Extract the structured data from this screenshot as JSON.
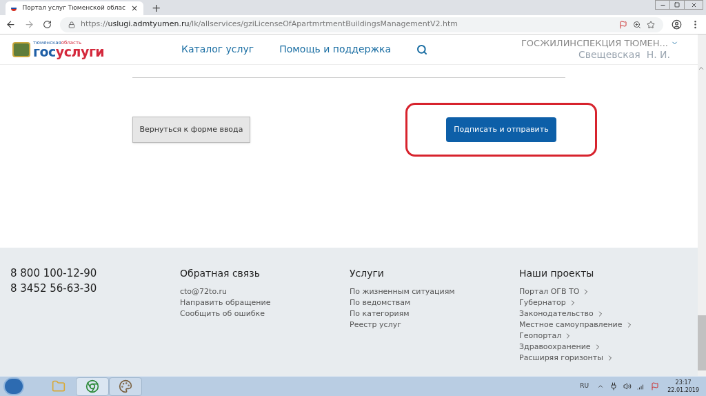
{
  "browser": {
    "tab_title": "Портал услуг Тюменской облас",
    "tab_close": "×",
    "new_tab": "+",
    "url_scheme": "https://",
    "url_host": "uslugi.admtyumen.ru",
    "url_path": "/lk/allservices/gziLicenseOfApartmrtmentBuildingsManagementV2.htm"
  },
  "header": {
    "logo_region_1": "тюменская",
    "logo_region_2": "область",
    "logo_word_1": "гос",
    "logo_word_2": "услуги",
    "nav": [
      "Каталог услуг",
      "Помощь и поддержка"
    ],
    "organization": "ГОСЖИЛИНСПЕКЦИЯ ТЮМЕН...",
    "user": "Свещевская  Н. И."
  },
  "form": {
    "back_button": "Вернуться к форме ввода",
    "submit_button": "Подписать и отправить",
    "submit_highlighted": true
  },
  "footer": {
    "phones": [
      "8 800 100-12-90",
      "8 3452 56-63-30"
    ],
    "columns": [
      {
        "title": "Обратная связь",
        "links": [
          "cto@72to.ru",
          "Направить обращение",
          "Сообщить об ошибке"
        ],
        "chevrons": false
      },
      {
        "title": "Услуги",
        "links": [
          "По жизненным ситуациям",
          "По ведомствам",
          "По категориям",
          "Реестр услуг"
        ],
        "chevrons": false
      },
      {
        "title": "Наши проекты",
        "links": [
          "Портал ОГВ ТО",
          "Губернатор",
          "Законодательство",
          "Местное самоуправление",
          "Геопортал",
          "Здравоохранение",
          "Расширяя горизонты"
        ],
        "chevrons": true
      }
    ]
  },
  "taskbar": {
    "language": "RU",
    "time": "23:17",
    "date": "22.01.2019"
  }
}
